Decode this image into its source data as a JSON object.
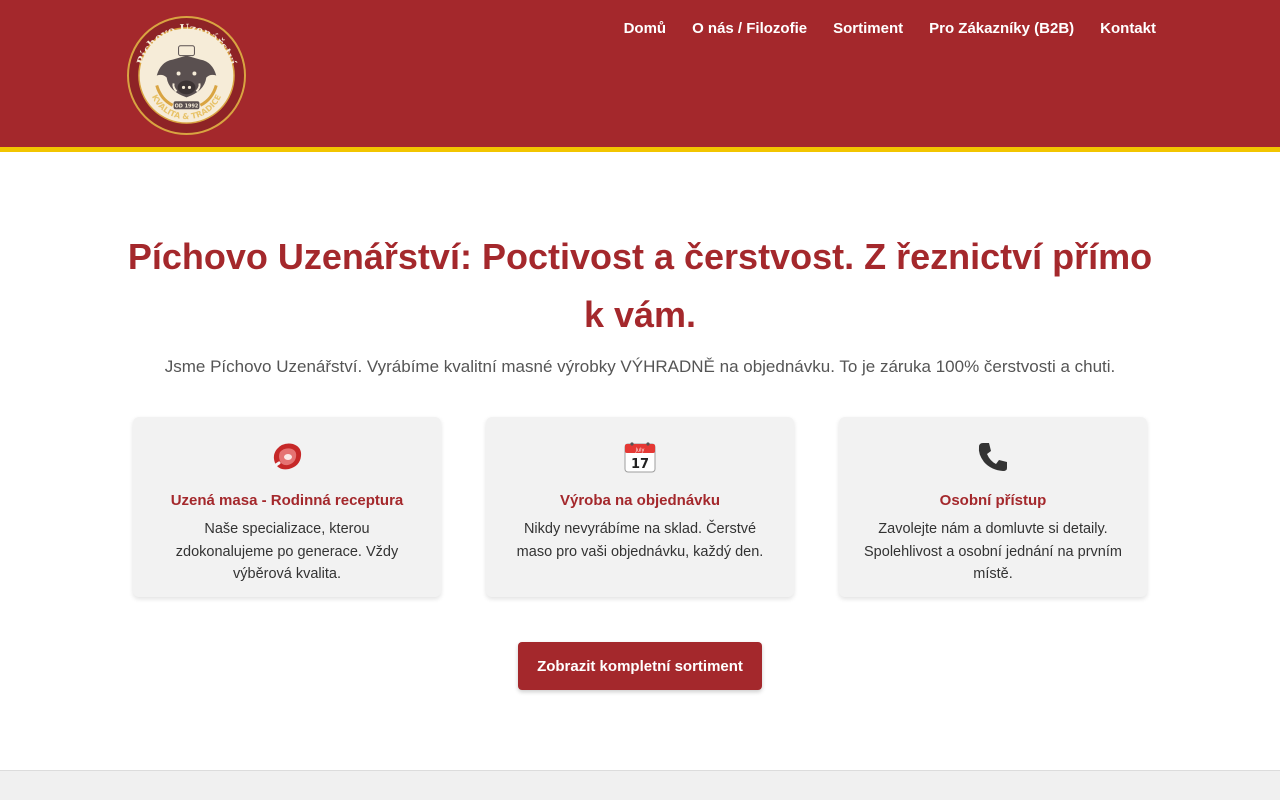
{
  "colors": {
    "brand_red": "#a4282c",
    "accent_yellow": "#f2c500",
    "card_bg": "#f2f2f2"
  },
  "logo": {
    "name_text": "Píchovo Uzenářství",
    "motto_text": "KVALITA & TRADICE",
    "since_text": "OD 1992",
    "icon": "boar-head-icon"
  },
  "nav": {
    "items": [
      {
        "label": "Domů"
      },
      {
        "label": "O nás / Filozofie"
      },
      {
        "label": "Sortiment"
      },
      {
        "label": "Pro Zákazníky (B2B)"
      },
      {
        "label": "Kontakt"
      }
    ]
  },
  "hero": {
    "title": "Píchovo Uzenářství: Poctivost a čerstvost. Z řeznictví přímo k vám.",
    "subtitle": "Jsme Píchovo Uzenářství. Vyrábíme kvalitní masné výrobky VÝHRADNĚ na objednávku. To je záruka 100% čerstvosti a chuti."
  },
  "features": [
    {
      "icon": "meat-icon",
      "title": "Uzená masa - Rodinná receptura",
      "text": "Naše specializace, kterou zdokonalujeme po generace. Vždy výběrová kvalita."
    },
    {
      "icon": "calendar-icon",
      "title": "Výroba na objednávku",
      "text": "Nikdy nevyrábíme na sklad. Čerstvé maso pro vaši objednávku, každý den.",
      "calendar_month": "July",
      "calendar_day": "17"
    },
    {
      "icon": "phone-icon",
      "title": "Osobní přístup",
      "text": "Zavolejte nám a domluvte si detaily. Spolehlivost a osobní jednání na prvním místě."
    }
  ],
  "cta": {
    "label": "Zobrazit kompletní sortiment"
  }
}
